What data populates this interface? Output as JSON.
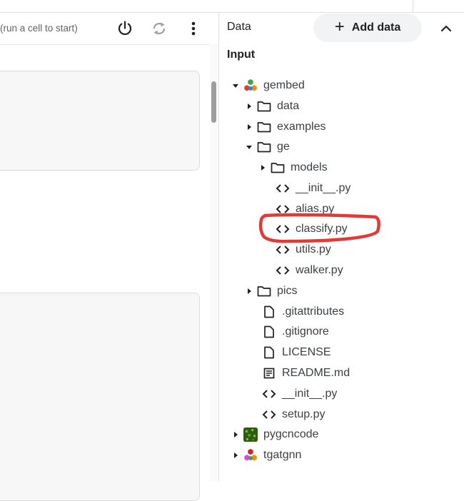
{
  "notebook": {
    "status_text": "(run a cell to start)"
  },
  "data_panel": {
    "title": "Data",
    "add_data_label": "Add data",
    "section_label": "Input",
    "tree": [
      {
        "label": "gembed",
        "kind": "dataset",
        "expanded": true
      },
      {
        "label": "data",
        "kind": "folder",
        "expanded": false
      },
      {
        "label": "examples",
        "kind": "folder",
        "expanded": false
      },
      {
        "label": "ge",
        "kind": "folder",
        "expanded": true
      },
      {
        "label": "models",
        "kind": "folder",
        "expanded": false
      },
      {
        "label": "__init__.py",
        "kind": "code"
      },
      {
        "label": "alias.py",
        "kind": "code"
      },
      {
        "label": "classify.py",
        "kind": "code",
        "highlighted": true
      },
      {
        "label": "utils.py",
        "kind": "code"
      },
      {
        "label": "walker.py",
        "kind": "code"
      },
      {
        "label": "pics",
        "kind": "folder",
        "expanded": false
      },
      {
        "label": ".gitattributes",
        "kind": "file"
      },
      {
        "label": ".gitignore",
        "kind": "file"
      },
      {
        "label": "LICENSE",
        "kind": "file"
      },
      {
        "label": "README.md",
        "kind": "doc"
      },
      {
        "label": "__init__.py",
        "kind": "code"
      },
      {
        "label": "setup.py",
        "kind": "code"
      },
      {
        "label": "pygcncode",
        "kind": "dataset",
        "expanded": false
      },
      {
        "label": "tgatgnn",
        "kind": "dataset",
        "expanded": false
      }
    ]
  },
  "colors": {
    "highlight": "#e53935",
    "button_bg": "#f1f3f4"
  }
}
